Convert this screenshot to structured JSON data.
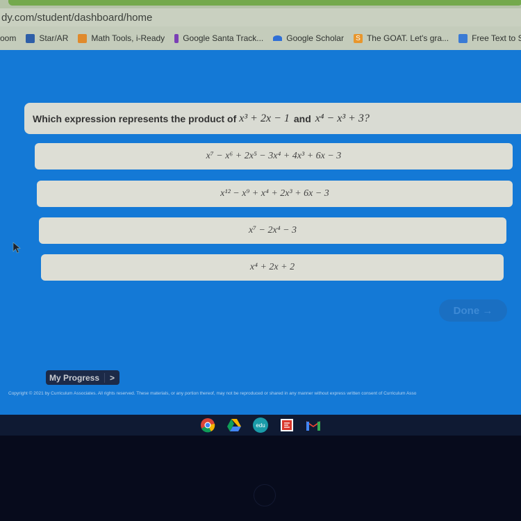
{
  "browser": {
    "url": "dy.com/student/dashboard/home",
    "bookmarks": [
      {
        "label": "oom",
        "icon": "none"
      },
      {
        "label": "Star/AR",
        "icon": "renaissance-icon",
        "color": "#2e5ea8"
      },
      {
        "label": "Math Tools, i-Ready",
        "icon": "math-tools-icon",
        "color": "#e08a2c"
      },
      {
        "label": "Google Santa Track...",
        "icon": "santa-tracker-icon",
        "color": "#7b3fb5"
      },
      {
        "label": "Google Scholar",
        "icon": "scholar-icon",
        "color": "#2f6fd6"
      },
      {
        "label": "The GOAT. Let's gra...",
        "icon": "s-icon",
        "color": "#e8962c"
      },
      {
        "label": "Free Text to Speech...",
        "icon": "speech-icon",
        "color": "#3a7bd5"
      }
    ]
  },
  "question": {
    "prefix": "Which expression represents the product of",
    "expr1": "x³ + 2x − 1",
    "conjunction": "and",
    "expr2": "x⁴ − x³ + 3?"
  },
  "choices": [
    {
      "label": "x⁷ − x⁶ + 2x⁵ − 3x⁴ + 4x³ + 6x − 3"
    },
    {
      "label": "x¹² − x⁹ + x⁴ + 2x³ + 6x − 3"
    },
    {
      "label": "x⁷ − 2x⁴ − 3"
    },
    {
      "label": "x⁴ + 2x + 2"
    }
  ],
  "done_button": {
    "label": "Done →",
    "state": "disabled"
  },
  "my_progress": {
    "label": "My Progress",
    "arrow": ">"
  },
  "copyright": "Copyright © 2021 by Curriculum Associates. All rights reserved. These materials, or any portion thereof, may not be reproduced or shared in any manner without express written consent of Curriculum Asso",
  "shelf_apps": [
    {
      "name": "chrome-icon"
    },
    {
      "name": "google-drive-icon"
    },
    {
      "name": "edu-icon",
      "label": "edu"
    },
    {
      "name": "sketchup-icon"
    },
    {
      "name": "gmail-icon"
    }
  ]
}
